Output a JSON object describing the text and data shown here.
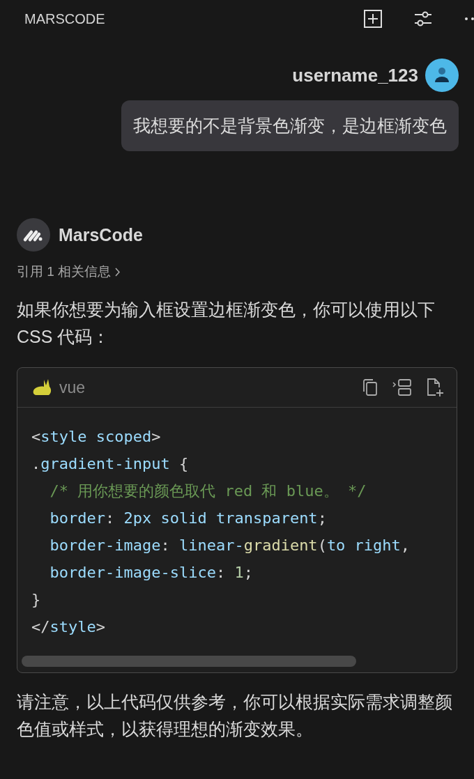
{
  "header": {
    "title": "MARSCODE"
  },
  "user_message": {
    "username": "username_123",
    "text": "我想要的不是背景色渐变，是边框渐变色"
  },
  "assistant": {
    "name": "MarsCode",
    "citation": "引用 1 相关信息",
    "intro": "如果你想要为输入框设置边框渐变色，你可以使用以下 CSS 代码：",
    "code_block": {
      "language": "vue",
      "lines": [
        [
          {
            "kind": "punct",
            "text": "<"
          },
          {
            "kind": "name",
            "text": "style scoped"
          },
          {
            "kind": "punct",
            "text": ">"
          }
        ],
        [
          {
            "kind": "punct",
            "text": "."
          },
          {
            "kind": "name",
            "text": "gradient-input"
          },
          {
            "kind": "punct",
            "text": " {"
          }
        ],
        [
          {
            "kind": "comment",
            "text": "  /* 用你想要的颜色取代 red 和 blue。 */"
          }
        ],
        [
          {
            "kind": "name",
            "text": "  border"
          },
          {
            "kind": "punct",
            "text": ": "
          },
          {
            "kind": "name",
            "text": "2px solid transparent"
          },
          {
            "kind": "punct",
            "text": ";"
          }
        ],
        [
          {
            "kind": "name",
            "text": "  border-image"
          },
          {
            "kind": "punct",
            "text": ": "
          },
          {
            "kind": "name",
            "text": "linear-"
          },
          {
            "kind": "func",
            "text": "gradient"
          },
          {
            "kind": "punct",
            "text": "("
          },
          {
            "kind": "name",
            "text": "to right"
          },
          {
            "kind": "punct",
            "text": ","
          }
        ],
        [
          {
            "kind": "name",
            "text": "  border-image-slice"
          },
          {
            "kind": "punct",
            "text": ": "
          },
          {
            "kind": "number",
            "text": "1"
          },
          {
            "kind": "punct",
            "text": ";"
          }
        ],
        [
          {
            "kind": "punct",
            "text": "}"
          }
        ],
        [
          {
            "kind": "punct",
            "text": "</"
          },
          {
            "kind": "name",
            "text": "style"
          },
          {
            "kind": "punct",
            "text": ">"
          }
        ]
      ]
    },
    "outro": "请注意，以上代码仅供参考，你可以根据实际需求调整颜色值或样式，以获得理想的渐变效果。"
  }
}
